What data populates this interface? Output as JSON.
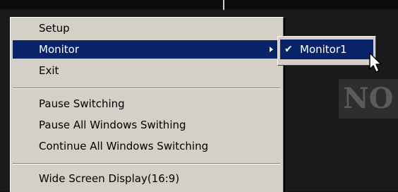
{
  "background": {
    "overlay_text": "NO"
  },
  "menu": {
    "items": [
      {
        "label": "Setup"
      },
      {
        "label": "Monitor",
        "has_submenu": true,
        "highlighted": true
      },
      {
        "label": "Exit"
      },
      {
        "label": "Pause Switching"
      },
      {
        "label": "Pause All Windows Swithing"
      },
      {
        "label": "Continue All Windows Switching"
      },
      {
        "label": "Wide Screen Display(16:9)"
      }
    ]
  },
  "submenu": {
    "items": [
      {
        "label": "Monitor1",
        "checked": true
      }
    ]
  },
  "colors": {
    "menu_background": "#d4d0c8",
    "highlight": "#0a246a",
    "highlight_text": "#ffffff"
  }
}
